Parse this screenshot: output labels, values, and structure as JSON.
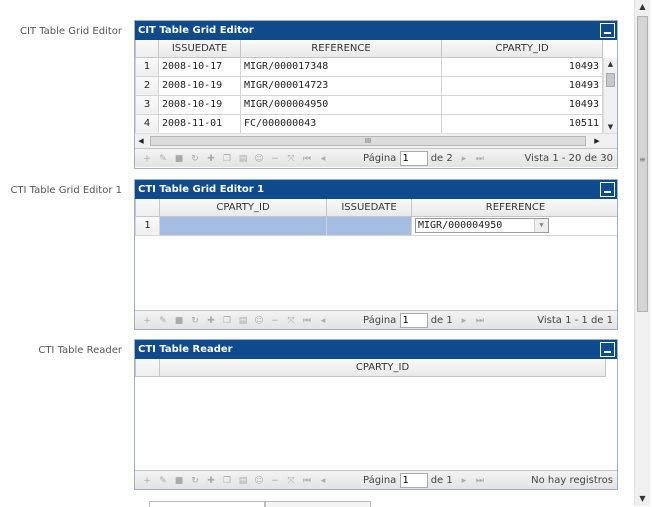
{
  "grid1": {
    "field_label": "CIT Table Grid Editor",
    "title": "CIT Table Grid Editor",
    "columns": [
      "",
      "ISSUEDATE",
      "REFERENCE",
      "CPARTY_ID"
    ],
    "rows": [
      {
        "n": "1",
        "issuedate": "2008-10-17",
        "reference": "MIGR/000017348",
        "cparty_id": "10493"
      },
      {
        "n": "2",
        "issuedate": "2008-10-19",
        "reference": "MIGR/000014723",
        "cparty_id": "10493"
      },
      {
        "n": "3",
        "issuedate": "2008-10-19",
        "reference": "MIGR/000004950",
        "cparty_id": "10493"
      },
      {
        "n": "4",
        "issuedate": "2008-11-01",
        "reference": "FC/000000043",
        "cparty_id": "10511"
      }
    ],
    "pager": {
      "page_label": "Página",
      "page_value": "1",
      "of_label": "de 2",
      "info": "Vista 1 - 20 de 30"
    }
  },
  "grid2": {
    "field_label": "CTI Table Grid Editor 1",
    "title": "CTI Table Grid Editor 1",
    "columns": [
      "",
      "CPARTY_ID",
      "ISSUEDATE",
      "REFERENCE"
    ],
    "rows": [
      {
        "n": "1",
        "cparty_id": "",
        "issuedate": "",
        "reference": "MIGR/000004950"
      }
    ],
    "pager": {
      "page_label": "Página",
      "page_value": "1",
      "of_label": "de 1",
      "info": "Vista 1 - 1 de 1"
    }
  },
  "grid3": {
    "field_label": "CTI Table Reader",
    "title": "CTI Table Reader",
    "columns": [
      "",
      "CPARTY_ID"
    ],
    "pager": {
      "page_label": "Página",
      "page_value": "1",
      "of_label": "de 1",
      "info": "No hay registros"
    }
  },
  "icons": {
    "toolbar": [
      "add-icon",
      "edit-icon",
      "delete-icon",
      "refresh-icon",
      "move-icon",
      "copy-icon",
      "paste-icon",
      "user-icon",
      "minus-icon",
      "expand-icon"
    ],
    "nav": [
      "first-page-icon",
      "prev-page-icon",
      "next-page-icon",
      "last-page-icon"
    ],
    "collapse": "collapse-icon",
    "hscroll_grip": "III",
    "page_grip": "≡"
  },
  "colors": {
    "titlebar": "#0f4a8b",
    "selected_cell": "#a6bde2"
  }
}
